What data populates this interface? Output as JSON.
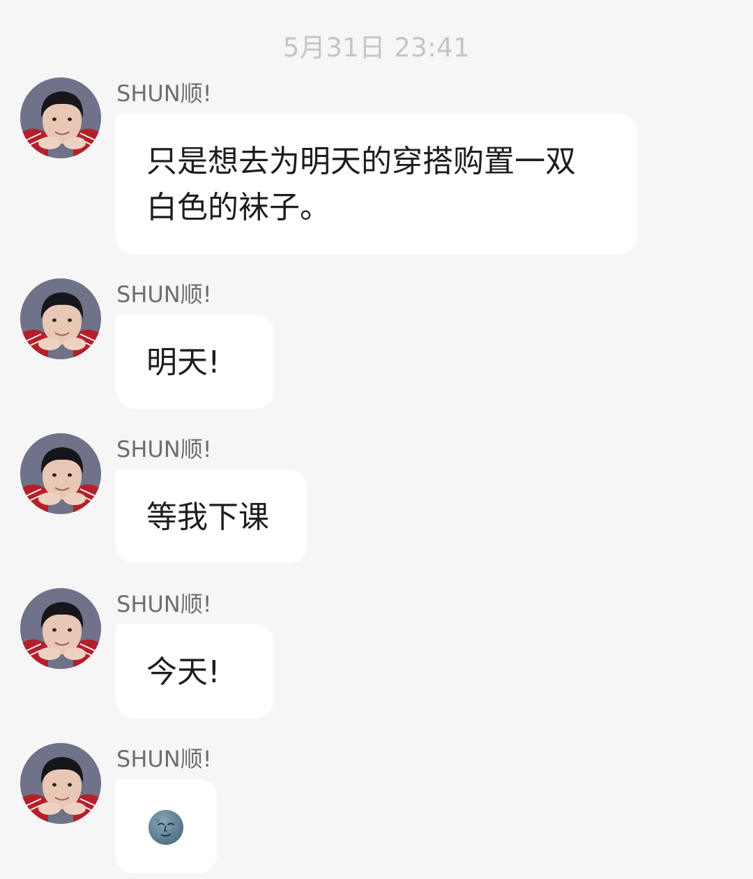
{
  "chat": {
    "timestamp": "5月31日 23:41",
    "messages": [
      {
        "sender": "SHUN顺!",
        "text": "只是想去为明天的穿搭购置一双\n白色的袜子。"
      },
      {
        "sender": "SHUN顺!",
        "text": "明天!"
      },
      {
        "sender": "SHUN顺!",
        "text": "等我下课"
      },
      {
        "sender": "SHUN顺!",
        "text": "今天!"
      },
      {
        "sender": "SHUN顺!",
        "emoji": "new-moon-face-emoji"
      }
    ]
  },
  "colors": {
    "background": "#f6f6f7",
    "bubble": "#ffffff",
    "sender_text": "#6d6d72",
    "timestamp_text": "#c4c4c8"
  },
  "icons": {
    "avatar": "user-avatar-photo",
    "emoji": "new-moon-face-emoji"
  }
}
